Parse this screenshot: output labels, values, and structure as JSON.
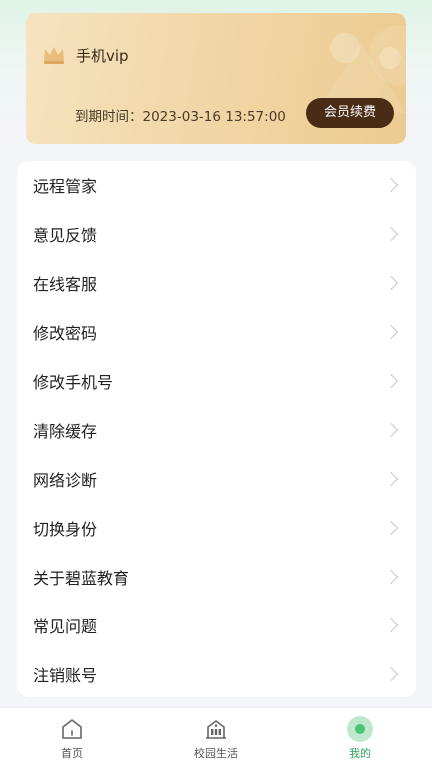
{
  "vip": {
    "title": "手机vip",
    "expire_text": "到期时间：2023-03-16 13:57:00",
    "renew_label": "会员续费"
  },
  "menu": {
    "items": [
      {
        "label": "远程管家"
      },
      {
        "label": "意见反馈"
      },
      {
        "label": "在线客服"
      },
      {
        "label": "修改密码"
      },
      {
        "label": "修改手机号"
      },
      {
        "label": "清除缓存"
      },
      {
        "label": "网络诊断"
      },
      {
        "label": "切换身份"
      },
      {
        "label": "关于碧蓝教育"
      },
      {
        "label": "常见问题"
      },
      {
        "label": "注销账号"
      }
    ]
  },
  "nav": {
    "items": [
      {
        "label": "首页",
        "icon": "home-icon"
      },
      {
        "label": "校园生活",
        "icon": "school-icon"
      },
      {
        "label": "我的",
        "icon": "profile-icon",
        "active": true
      }
    ]
  },
  "colors": {
    "accent": "#2ea35a",
    "renew_button": "#4a2c16",
    "vip_card": "#f1d7a8"
  }
}
